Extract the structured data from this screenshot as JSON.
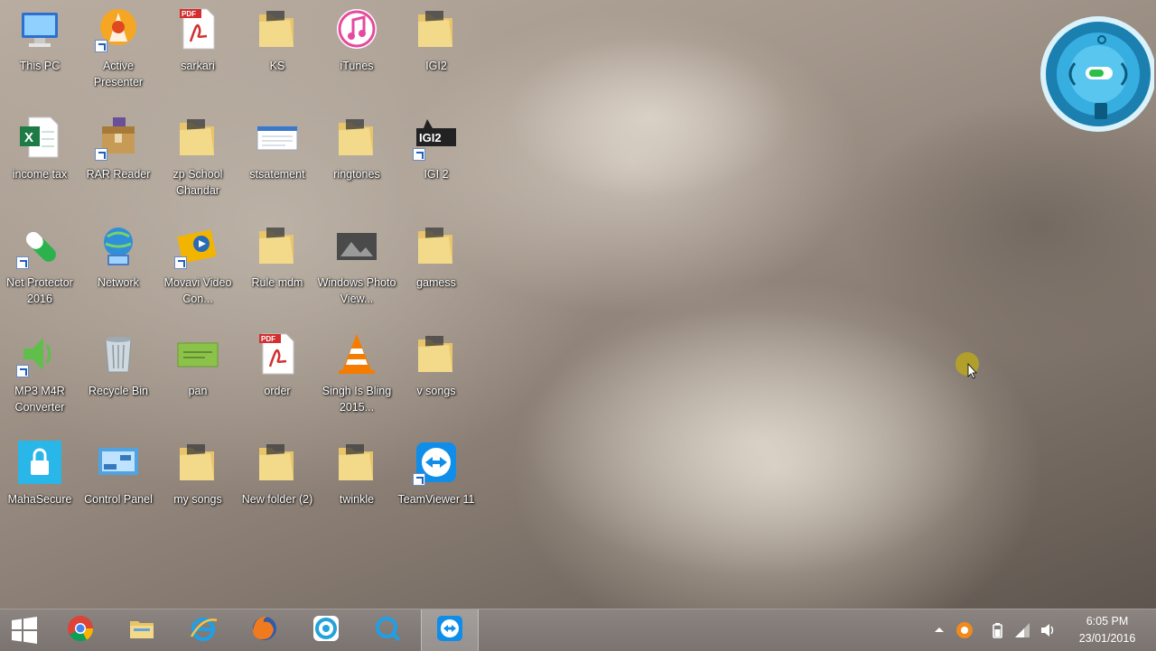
{
  "desktop": {
    "icons": [
      {
        "label": "This PC",
        "icon": "computer-icon",
        "shortcut": false
      },
      {
        "label": "Active Presenter",
        "icon": "active-presenter-icon",
        "shortcut": true
      },
      {
        "label": "sarkari",
        "icon": "pdf-file-icon",
        "shortcut": false
      },
      {
        "label": "KS",
        "icon": "folder-icon",
        "shortcut": false
      },
      {
        "label": "iTunes",
        "icon": "itunes-icon",
        "shortcut": false
      },
      {
        "label": "IGI2",
        "icon": "folder-icon",
        "shortcut": false
      },
      {
        "label": "income tax",
        "icon": "excel-file-icon",
        "shortcut": false
      },
      {
        "label": "RAR Reader",
        "icon": "rar-reader-icon",
        "shortcut": true
      },
      {
        "label": "zp School Chandar",
        "icon": "folder-icon",
        "shortcut": false
      },
      {
        "label": "stsatement",
        "icon": "document-icon",
        "shortcut": false
      },
      {
        "label": "ringtones",
        "icon": "folder-icon",
        "shortcut": false
      },
      {
        "label": "IGI 2",
        "icon": "igi2-game-icon",
        "shortcut": true
      },
      {
        "label": "Net Protector 2016",
        "icon": "net-protector-icon",
        "shortcut": true
      },
      {
        "label": "Network",
        "icon": "network-icon",
        "shortcut": false
      },
      {
        "label": "Movavi Video Con...",
        "icon": "movavi-icon",
        "shortcut": true
      },
      {
        "label": "Rule mdm",
        "icon": "folder-icon",
        "shortcut": false
      },
      {
        "label": "Windows Photo View...",
        "icon": "photo-viewer-icon",
        "shortcut": false
      },
      {
        "label": "gamess",
        "icon": "folder-icon",
        "shortcut": false
      },
      {
        "label": "MP3 M4R Converter",
        "icon": "mp3-converter-icon",
        "shortcut": true
      },
      {
        "label": "Recycle Bin",
        "icon": "recycle-bin-icon",
        "shortcut": false
      },
      {
        "label": "pan",
        "icon": "image-file-icon",
        "shortcut": false
      },
      {
        "label": "order",
        "icon": "pdf-file-icon",
        "shortcut": false
      },
      {
        "label": "Singh Is Bling 2015...",
        "icon": "vlc-icon",
        "shortcut": false
      },
      {
        "label": "v songs",
        "icon": "folder-icon",
        "shortcut": false
      },
      {
        "label": "MahaSecure",
        "icon": "mahasecure-icon",
        "shortcut": false
      },
      {
        "label": "Control Panel",
        "icon": "control-panel-icon",
        "shortcut": false
      },
      {
        "label": "my songs",
        "icon": "folder-icon",
        "shortcut": false
      },
      {
        "label": "New folder (2)",
        "icon": "folder-icon",
        "shortcut": false
      },
      {
        "label": "twinkle",
        "icon": "folder-icon",
        "shortcut": false
      },
      {
        "label": "TeamViewer 11",
        "icon": "teamviewer-icon",
        "shortcut": true
      }
    ]
  },
  "gadget": {
    "icon": "net-protector-gadget-icon"
  },
  "taskbar": {
    "start_icon": "windows-start-icon",
    "pinned": [
      {
        "icon": "chrome-icon",
        "active": false
      },
      {
        "icon": "file-explorer-icon",
        "active": false
      },
      {
        "icon": "internet-explorer-icon",
        "active": false
      },
      {
        "icon": "firefox-icon",
        "active": false
      },
      {
        "icon": "app-ring-icon",
        "active": false
      },
      {
        "icon": "search-app-icon",
        "active": false
      },
      {
        "icon": "teamviewer-icon",
        "active": true
      }
    ],
    "tray": {
      "icons": [
        "chevron-up-icon",
        "avast-icon",
        "battery-icon",
        "signal-icon",
        "volume-icon"
      ],
      "time": "6:05 PM",
      "date": "23/01/2016"
    }
  }
}
